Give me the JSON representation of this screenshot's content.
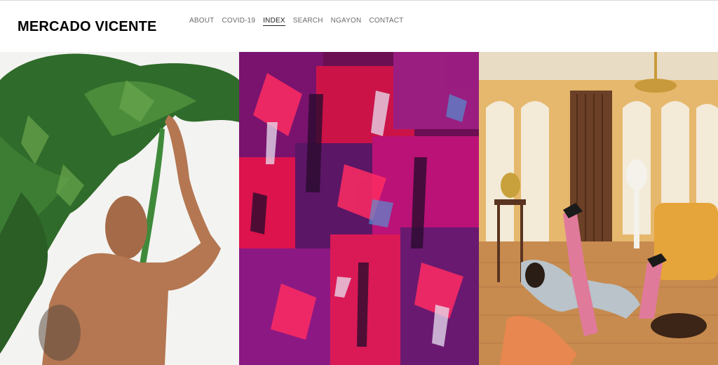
{
  "site": {
    "title": "MERCADO VICENTE"
  },
  "nav": {
    "items": [
      {
        "label": "ABOUT",
        "active": false
      },
      {
        "label": "COVID-19",
        "active": false
      },
      {
        "label": "INDEX",
        "active": true
      },
      {
        "label": "SEARCH",
        "active": false
      },
      {
        "label": "NGAYON",
        "active": false
      },
      {
        "label": "CONTACT",
        "active": false
      }
    ]
  },
  "gallery": {
    "images": [
      {
        "name": "portrait-with-leaf",
        "accent": "#2f6b2a"
      },
      {
        "name": "abstract-painting",
        "accent": "#e8154f"
      },
      {
        "name": "ornate-room-scene",
        "accent": "#d9a24d"
      }
    ]
  },
  "colors": {
    "text": "#000000",
    "nav": "#6b6b6b",
    "nav_active": "#222222"
  }
}
